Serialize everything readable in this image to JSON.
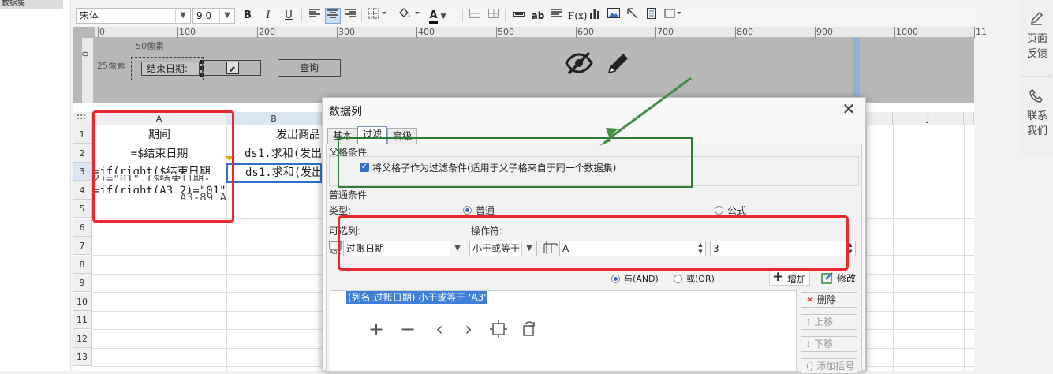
{
  "left_panel": {
    "tab_label": "数据集"
  },
  "toolbar": {
    "font_family": "宋体",
    "font_size": "9.0",
    "bold": "B",
    "italic": "I",
    "underline": "U",
    "text_color_label": "A",
    "text_label": "ab",
    "fx_label": "F(x)"
  },
  "ruler": {
    "top_ticks": [
      "0",
      "100",
      "200",
      "300",
      "400",
      "500",
      "600",
      "700",
      "800",
      "900",
      "1000",
      "11"
    ],
    "left_tick": "0"
  },
  "param_panel": {
    "width_hint": "50像素",
    "height_hint": "25像素",
    "end_date_label": "结束日期:",
    "query_button": "查询"
  },
  "grid": {
    "column_headers": [
      "A",
      "B",
      "J"
    ],
    "row_numbers": [
      "1",
      "2",
      "3",
      "4",
      "5",
      "6",
      "7",
      "8",
      "9",
      "10",
      "11",
      "12",
      "13"
    ],
    "cells": {
      "a1": "期间",
      "a2": "=$结束日期",
      "a3": "=if(right($结束日期,",
      "a3_overflow": "2)=\"01\",($结束日期-",
      "a4": "=if(right(A3,2)=\"01\",",
      "a4_overflow": "A3-89,A3-1)",
      "b1": "发出商品",
      "b2": "ds1.求和(发出",
      "b3": "ds1.求和(发出"
    }
  },
  "dialog": {
    "title": "数据列",
    "close_icon": "✕",
    "tabs": [
      "基本",
      "过滤",
      "高级"
    ],
    "parent_section_title": "父格条件",
    "parent_checkbox_label": "将父格子作为过滤条件(适用于父子格来自于同一个数据集)",
    "normal_section_title": "普通条件",
    "type_label": "类型:",
    "type_normal": "普通",
    "type_formula": "公式",
    "column_label": "可选列:",
    "operator_label": "操作符:",
    "column_value": "过账日期",
    "operator_value": "小于或等于",
    "value_cell": "A",
    "value_row": "3",
    "and_label": "与(AND)",
    "or_label": "或(OR)",
    "add_button": "增加",
    "modify_button": "修改",
    "condition_item": "(列名:过账日期) 小于或等于 'A3'",
    "delete_button": "删除",
    "up_button": "上移",
    "down_button": "下移",
    "add_bracket_button": "添加括号"
  },
  "right_panel": {
    "feedback_label_1": "页面",
    "feedback_label_2": "反馈",
    "contact_label_1": "联系",
    "contact_label_2": "我们"
  },
  "colors": {
    "annotation_red": "#e8282a",
    "annotation_green": "#2e7d32",
    "arrow_green": "#3f8f3f",
    "selection_blue": "#2d6fc9"
  }
}
